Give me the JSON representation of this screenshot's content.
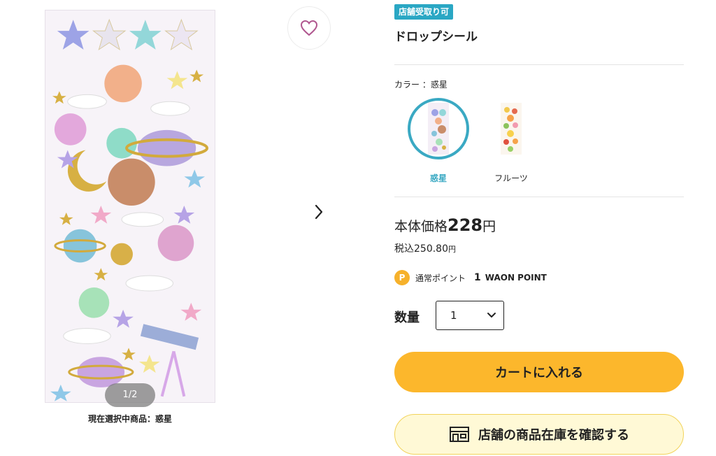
{
  "gallery": {
    "counter": "1/2",
    "caption": "現在選択中商品：惑星"
  },
  "product": {
    "badge": "店舗受取り可",
    "title": "ドロップシール"
  },
  "color": {
    "label": "カラー ：惑星",
    "options": [
      {
        "name": "惑星",
        "selected": true
      },
      {
        "name": "フルーツ",
        "selected": false
      }
    ]
  },
  "price": {
    "label": "本体価格",
    "amount": "228",
    "unit": "円",
    "tax_label": "税込250.80",
    "tax_unit": "円"
  },
  "points": {
    "icon_letter": "P",
    "label": "通常ポイント",
    "value": "1",
    "name": "WAON POINT"
  },
  "quantity": {
    "label": "数量",
    "value": "1"
  },
  "buttons": {
    "cart": "カートに入れる",
    "stock": "店舗の商品在庫を確認する"
  },
  "colors": {
    "accent": "#2aa7c4",
    "cart": "#fcb72c",
    "stock_bg": "#fff9d6",
    "points": "#f6b12b",
    "heart": "#b0578f"
  }
}
